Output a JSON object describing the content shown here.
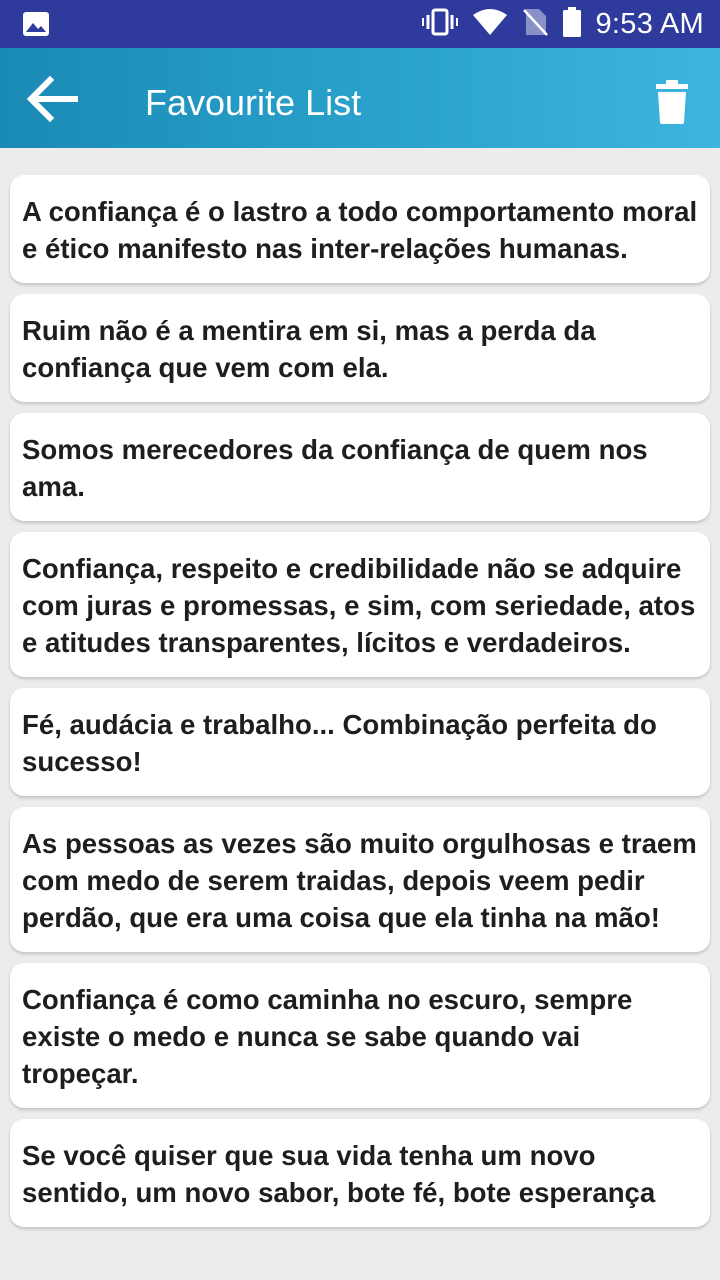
{
  "status_bar": {
    "time": "9:53 AM",
    "icons": [
      "image-icon",
      "vibrate-icon",
      "wifi-icon",
      "no-sim-icon",
      "battery-icon"
    ]
  },
  "app_bar": {
    "title": "Favourite List",
    "back_icon": "arrow-left-icon",
    "delete_icon": "trash-icon",
    "gradient_colors": [
      "#1a8ab5",
      "#3db5de"
    ]
  },
  "quotes": [
    "A confiança é o lastro a todo comportamento moral e ético manifesto nas inter-relações humanas.",
    "Ruim não é a mentira em si, mas a perda da confiança que vem com ela.",
    "Somos merecedores da confiança de quem nos ama.",
    "Confiança, respeito e credibilidade não se adquire com juras e promessas, e sim, com seriedade, atos e atitudes transparentes, lícitos e verdadeiros.",
    "Fé, audácia e trabalho... Combinação perfeita do sucesso!",
    "As pessoas as vezes são muito orgulhosas e traem com medo de serem traidas, depois veem pedir perdão, que era uma coisa que ela tinha na mão!",
    "Confiança é como caminha no escuro, sempre existe o medo e nunca se sabe quando vai tropeçar.",
    "Se você quiser que sua vida tenha um novo sentido, um novo sabor, bote fé, bote esperança"
  ]
}
